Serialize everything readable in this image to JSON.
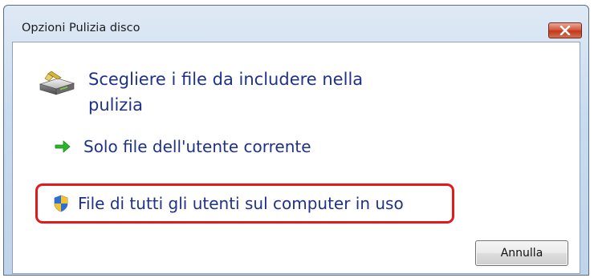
{
  "window": {
    "title": "Opzioni Pulizia disco"
  },
  "prompt": {
    "heading": "Scegliere i file da includere nella pulizia"
  },
  "options": [
    {
      "label": "Solo file dell'utente corrente",
      "icon": "green-arrow-icon"
    },
    {
      "label": "File di tutti gli utenti sul computer in uso",
      "icon": "uac-shield-icon",
      "highlighted": true
    }
  ],
  "buttons": {
    "cancel_label": "Annulla"
  },
  "colors": {
    "link_text": "#1e3287",
    "highlight_border": "#e21a1a",
    "close_button": "#c8452a"
  }
}
